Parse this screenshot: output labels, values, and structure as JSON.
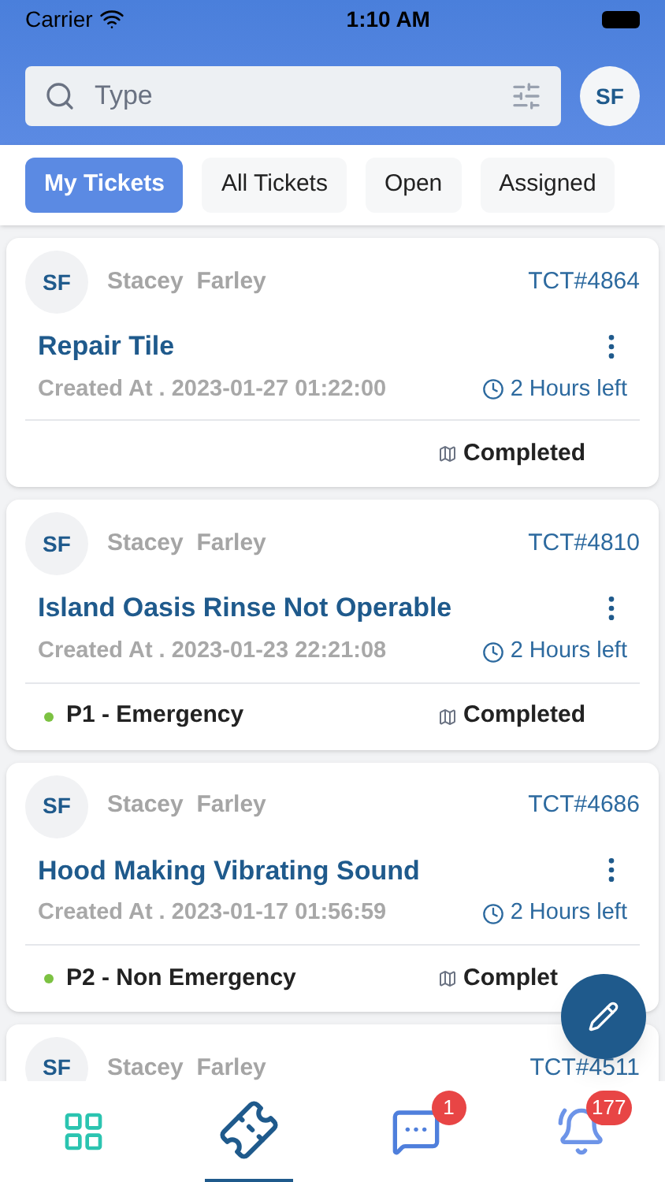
{
  "status_bar": {
    "carrier": "Carrier",
    "time": "1:10 AM"
  },
  "search": {
    "placeholder": "Type"
  },
  "profile": {
    "initials": "SF"
  },
  "tabs": [
    {
      "label": "My Tickets",
      "selected": true
    },
    {
      "label": "All Tickets",
      "selected": false
    },
    {
      "label": "Open",
      "selected": false
    },
    {
      "label": "Assigned",
      "selected": false
    }
  ],
  "tickets": [
    {
      "initials": "SF",
      "name": "Stacey  Farley",
      "number": "TCT#4864",
      "title": "Repair Tile",
      "created": "Created At . 2023-01-27 01:22:00",
      "time_left": "2 Hours left",
      "status": "Completed"
    },
    {
      "initials": "SF",
      "name": "Stacey  Farley",
      "number": "TCT#4810",
      "title": "Island Oasis Rinse Not Operable",
      "created": "Created At . 2023-01-23 22:21:08",
      "time_left": "2 Hours left",
      "priority": {
        "label": "P1 - Emergency",
        "color": "#7cc242"
      },
      "status": "Completed"
    },
    {
      "initials": "SF",
      "name": "Stacey  Farley",
      "number": "TCT#4686",
      "title": "Hood Making Vibrating Sound",
      "created": "Created At . 2023-01-17 01:56:59",
      "time_left": "2 Hours left",
      "priority": {
        "label": "P2 - Non Emergency",
        "color": "#7cc242"
      },
      "status": "Complet"
    },
    {
      "initials": "SF",
      "name": "Stacey  Farley",
      "number": "TCT#4511"
    }
  ],
  "nav": [
    {
      "kind": "dashboard",
      "selected": false
    },
    {
      "kind": "tickets",
      "selected": true
    },
    {
      "kind": "chat",
      "selected": false,
      "badge": "1"
    },
    {
      "kind": "alerts",
      "selected": false,
      "badge": "177"
    }
  ]
}
